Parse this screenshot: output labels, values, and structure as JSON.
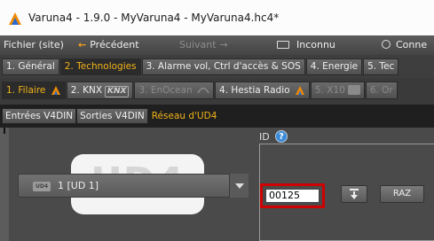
{
  "window": {
    "title": "Varuna4 - 1.9.0 - MyVaruna4 - MyVaruna4.hc4*",
    "icon": "varuna-app-icon"
  },
  "menu": {
    "file": "Fichier (site)",
    "previous": "Précédent",
    "next": "Suivant",
    "unknown": "Inconnu",
    "connect": "Conne"
  },
  "main_tabs": [
    {
      "label": "1. Général"
    },
    {
      "label": "2. Technologies",
      "active": true
    },
    {
      "label": "3. Alarme vol, Ctrl d'accès & SOS"
    },
    {
      "label": "4. Energie"
    },
    {
      "label": "5. Tec"
    }
  ],
  "tech_tabs": [
    {
      "label": "1. Filaire",
      "active": true,
      "icon": "hager-icon"
    },
    {
      "label": "2. KNX",
      "logo": "KNX"
    },
    {
      "label": "3. EnOcean",
      "disabled": true
    },
    {
      "label": "4. Hestia Radio",
      "icon": "hager-icon"
    },
    {
      "label": "5. X10",
      "disabled": true
    },
    {
      "label": "6. Or",
      "disabled": true
    }
  ],
  "sub_tabs": [
    {
      "label": "Entrées V4DIN"
    },
    {
      "label": "Sorties V4DIN"
    },
    {
      "label": "Réseau d'UD4",
      "active": true
    }
  ],
  "device": {
    "badge": "UD4",
    "selected": "1 [UD 1]",
    "image_text": "UD4"
  },
  "id_panel": {
    "label": "ID",
    "value": "00125",
    "raz_label": "RAZ"
  },
  "colors": {
    "accent": "#f2b318",
    "highlight_border": "#d00000",
    "help_blue": "#3a8ad9"
  }
}
